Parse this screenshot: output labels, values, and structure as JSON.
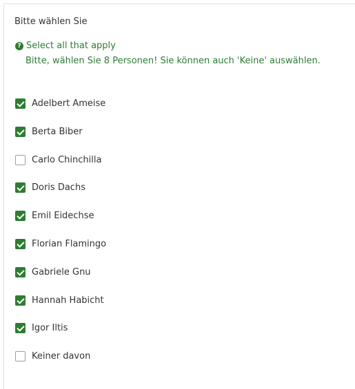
{
  "question": {
    "title": "Bitte wählen Sie",
    "help_icon": "question-circle-icon",
    "help_text": "Select all that apply",
    "tip_text": "Bitte, wählen Sie 8 Personen! Sie können auch 'Keine' auswählen."
  },
  "colors": {
    "accent": "#2e7d32",
    "help_text": "#2d7d32",
    "text": "#333333"
  },
  "options": [
    {
      "label": "Adelbert Ameise",
      "checked": true
    },
    {
      "label": "Berta Biber",
      "checked": true
    },
    {
      "label": "Carlo Chinchilla",
      "checked": false
    },
    {
      "label": "Doris Dachs",
      "checked": true
    },
    {
      "label": "Emil Eidechse",
      "checked": true
    },
    {
      "label": "Florian Flamingo",
      "checked": true
    },
    {
      "label": "Gabriele Gnu",
      "checked": true
    },
    {
      "label": "Hannah Habicht",
      "checked": true
    },
    {
      "label": "Igor Iltis",
      "checked": true
    },
    {
      "label": "Keiner davon",
      "checked": false
    }
  ]
}
